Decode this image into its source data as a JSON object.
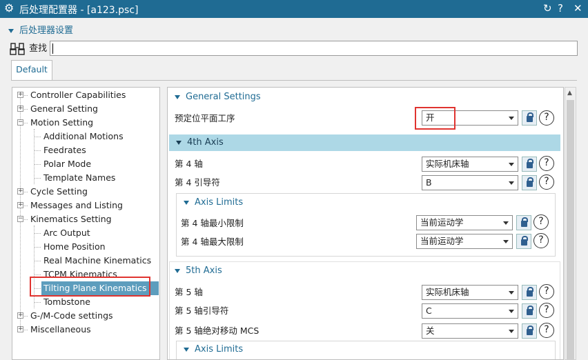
{
  "window": {
    "title": "后处理配置器 - [a123.psc]"
  },
  "section": {
    "label": "后处理器设置"
  },
  "find": {
    "label": "查找",
    "value": ""
  },
  "tabs": [
    {
      "label": "Default"
    }
  ],
  "tree": [
    {
      "label": "Controller Capabilities",
      "level": 0,
      "expander": "+"
    },
    {
      "label": "General Setting",
      "level": 0,
      "expander": "+"
    },
    {
      "label": "Motion Setting",
      "level": 0,
      "expander": "−"
    },
    {
      "label": "Additional Motions",
      "level": 1
    },
    {
      "label": "Feedrates",
      "level": 1
    },
    {
      "label": "Polar Mode",
      "level": 1
    },
    {
      "label": "Template Names",
      "level": 1
    },
    {
      "label": "Cycle Setting",
      "level": 0,
      "expander": "+"
    },
    {
      "label": "Messages and Listing",
      "level": 0,
      "expander": "+"
    },
    {
      "label": "Kinematics Setting",
      "level": 0,
      "expander": "−"
    },
    {
      "label": "Arc Output",
      "level": 1
    },
    {
      "label": "Home Position",
      "level": 1
    },
    {
      "label": "Real Machine Kinematics",
      "level": 1
    },
    {
      "label": "TCPM Kinematics",
      "level": 1
    },
    {
      "label": "Tilting Plane Kinematics",
      "level": 1,
      "selected": true
    },
    {
      "label": "Tombstone",
      "level": 1
    },
    {
      "label": "G-/M-Code settings",
      "level": 0,
      "expander": "+"
    },
    {
      "label": "Miscellaneous",
      "level": 0,
      "expander": "+"
    }
  ],
  "general": {
    "title": "General Settings",
    "row1": {
      "label": "预定位平面工序",
      "value": "开"
    }
  },
  "axis4": {
    "title": "4th Axis",
    "row_axis": {
      "label": "第 4 轴",
      "value": "实际机床轴"
    },
    "row_lead": {
      "label": "第 4 引导符",
      "value": "B"
    },
    "limits": {
      "title": "Axis Limits",
      "min": {
        "label": "第 4 轴最小限制",
        "value": "当前运动学"
      },
      "max": {
        "label": "第 4 轴最大限制",
        "value": "当前运动学"
      }
    }
  },
  "axis5": {
    "title": "5th Axis",
    "row_axis": {
      "label": "第 5 轴",
      "value": "实际机床轴"
    },
    "row_lead": {
      "label": "第 5 轴引导符",
      "value": "C"
    },
    "row_mcs": {
      "label": "第 5 轴绝对移动 MCS",
      "value": "关"
    },
    "limits": {
      "title": "Axis Limits"
    }
  },
  "colors": {
    "accent": "#1f6b93",
    "highlight": "#e0332f",
    "group_band": "#add8e6",
    "selection": "#5d9dbd"
  },
  "icons": [
    "gear-icon",
    "refresh-icon",
    "help-icon",
    "close-icon",
    "binoculars-icon",
    "lock-icon",
    "question-icon"
  ]
}
